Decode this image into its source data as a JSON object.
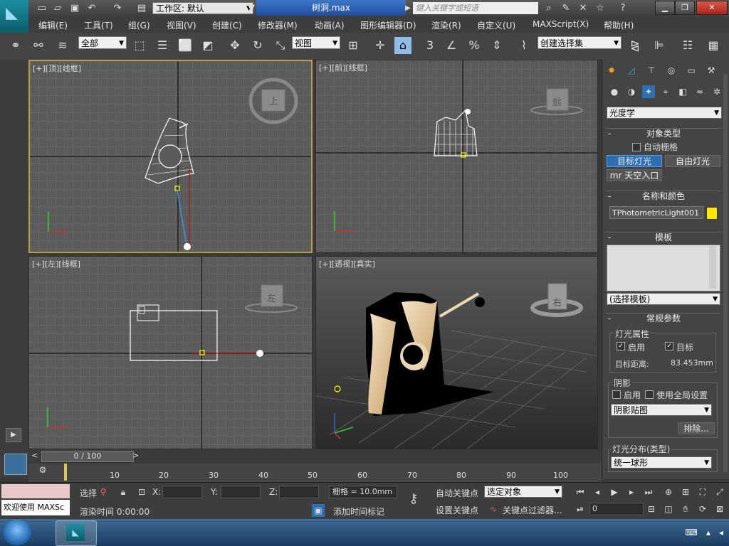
{
  "titlebar": {
    "workspace_label": "工作区: 默认",
    "document_title": "树洞.max",
    "search_placeholder": "键入关键字或短语"
  },
  "menu": {
    "items": [
      "编辑(E)",
      "工具(T)",
      "组(G)",
      "视图(V)",
      "创建(C)",
      "修改器(M)",
      "动画(A)",
      "图形编辑器(D)",
      "渲染(R)",
      "自定义(U)",
      "MAXScript(X)",
      "帮助(H)"
    ]
  },
  "toolbar": {
    "selection_filter": "全部",
    "ref_coord": "视图",
    "named_selection": "创建选择集",
    "snap_label": "3"
  },
  "viewports": {
    "top": {
      "label": "[+][顶][线框]",
      "cube_face": "上"
    },
    "front": {
      "label": "[+][前][线框]",
      "cube_face": "前"
    },
    "left": {
      "label": "[+][左][线框]",
      "cube_face": "左"
    },
    "perspective": {
      "label": "[+][透视][真实]",
      "cube_face": "右"
    }
  },
  "command_panel": {
    "category_dropdown": "光度学",
    "object_type": {
      "title": "对象类型",
      "auto_grid": "自动栅格",
      "target_light": "目标灯光",
      "free_light": "自由灯光",
      "sky_portal": "mr 天空入口"
    },
    "name_color": {
      "title": "名称和颜色",
      "name_value": "TPhotometricLight001",
      "color": "#ffe600"
    },
    "template": {
      "title": "模板",
      "dropdown": "(选择模板)"
    },
    "general": {
      "title": "常规参数",
      "light_props": "灯光属性",
      "enable": "启用",
      "target": "目标",
      "target_distance_label": "目标距离:",
      "target_distance_value": "83.453mm",
      "shadow_title": "阴影",
      "shadow_enable": "启用",
      "use_global": "使用全局设置",
      "shadow_type": "阴影贴图",
      "exclude": "排除...",
      "distribution_title": "灯光分布(类型)",
      "distribution_value": "统一球形"
    }
  },
  "timeline": {
    "frame_counter": "0 / 100",
    "ticks": [
      "10",
      "20",
      "30",
      "40",
      "50",
      "60",
      "70",
      "80",
      "90",
      "100"
    ]
  },
  "status": {
    "welcome": "欢迎使用 MAXSc",
    "select_label": "选择",
    "x_label": "X:",
    "y_label": "Y:",
    "z_label": "Z:",
    "grid": "栅格 = 10.0mm",
    "auto_key": "自动关键点",
    "selected_object": "选定对象",
    "set_key": "设置关键点",
    "key_filter": "关键点过滤器...",
    "render_time": "渲染时间  0:00:00",
    "add_time_tag": "添加时间标记",
    "frame_value": "0"
  }
}
